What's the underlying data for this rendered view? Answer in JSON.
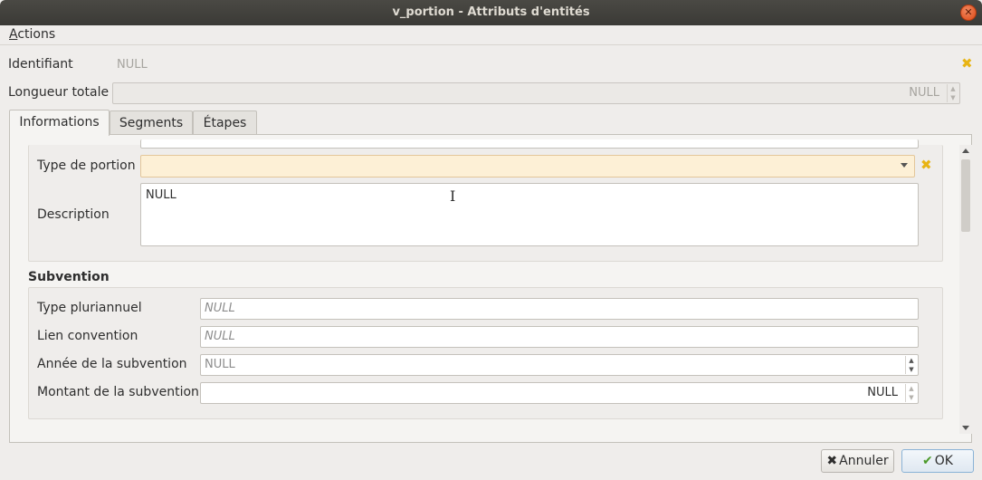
{
  "window": {
    "title": "v_portion - Attributs d'entités"
  },
  "menubar": {
    "actions": "Actions"
  },
  "top_fields": {
    "identifiant": {
      "label": "Identifiant",
      "value": "NULL"
    },
    "longueur_totale": {
      "label": "Longueur totale",
      "value": "NULL"
    }
  },
  "tabs": [
    {
      "label": "Informations",
      "active": true
    },
    {
      "label": "Segments",
      "active": false
    },
    {
      "label": "Étapes",
      "active": false
    }
  ],
  "informations": {
    "type_portion": {
      "label": "Type de portion",
      "value": ""
    },
    "description": {
      "label": "Description",
      "value": "NULL"
    }
  },
  "subvention": {
    "title": "Subvention",
    "type_pluriannuel": {
      "label": "Type pluriannuel",
      "placeholder": "NULL"
    },
    "lien_convention": {
      "label": "Lien convention",
      "placeholder": "NULL"
    },
    "annee": {
      "label": "Année de la subvention",
      "value": "NULL"
    },
    "montant": {
      "label": "Montant de la subvention",
      "value": "NULL"
    }
  },
  "buttons": {
    "cancel": "Annuler",
    "ok": "OK"
  },
  "icons": {
    "clear": "clear-x-icon",
    "close": "close-icon"
  },
  "colors": {
    "accent_clear": "#e8b414",
    "combo_bg": "#fdf0d6",
    "titlebar": "#3b3a36",
    "close": "#df4a16"
  }
}
